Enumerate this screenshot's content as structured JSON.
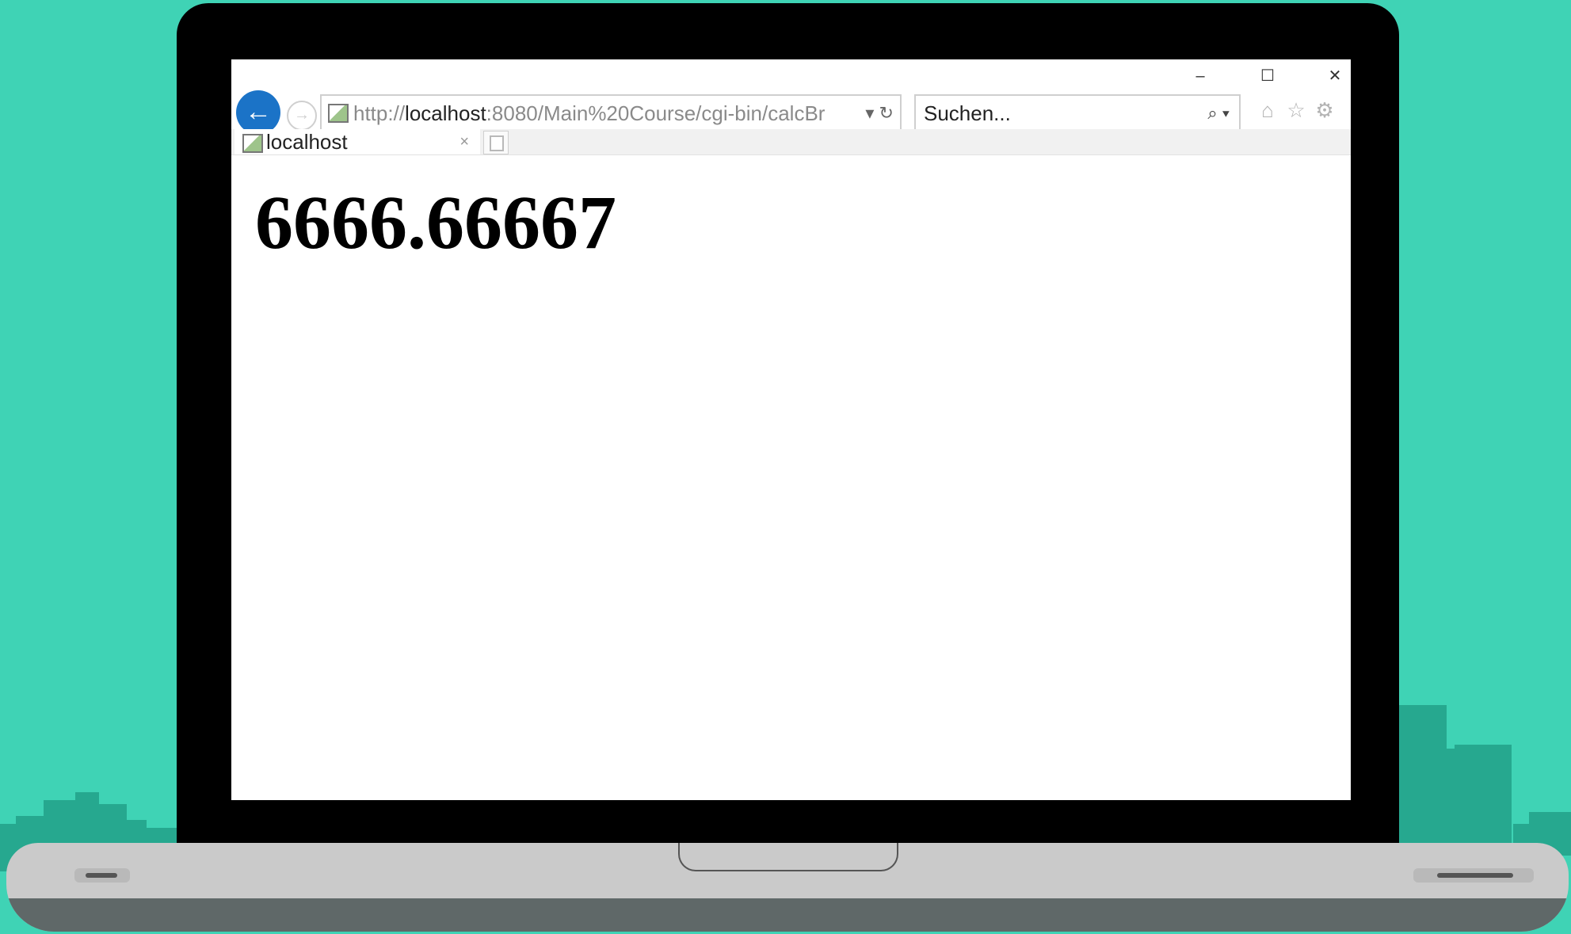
{
  "browser": {
    "window_controls": {
      "minimize": "–",
      "maximize": "☐",
      "close": "✕"
    },
    "address_bar": {
      "url_prefix": "http://",
      "url_host": "localhost",
      "url_rest": ":8080/Main%20Course/cgi-bin/calcBr",
      "tail_icons": "▾ ↻"
    },
    "search": {
      "placeholder": "Suchen...",
      "icon": "⌕ ▾"
    },
    "tool_icons": [
      "home-icon",
      "star-icon",
      "gear-icon"
    ],
    "tab": {
      "label": "localhost",
      "close": "×"
    }
  },
  "page": {
    "result": "6666.66667"
  },
  "colors": {
    "background": "#3fd3b5",
    "skyline": "#26a88f",
    "accent": "#1b73c7"
  }
}
